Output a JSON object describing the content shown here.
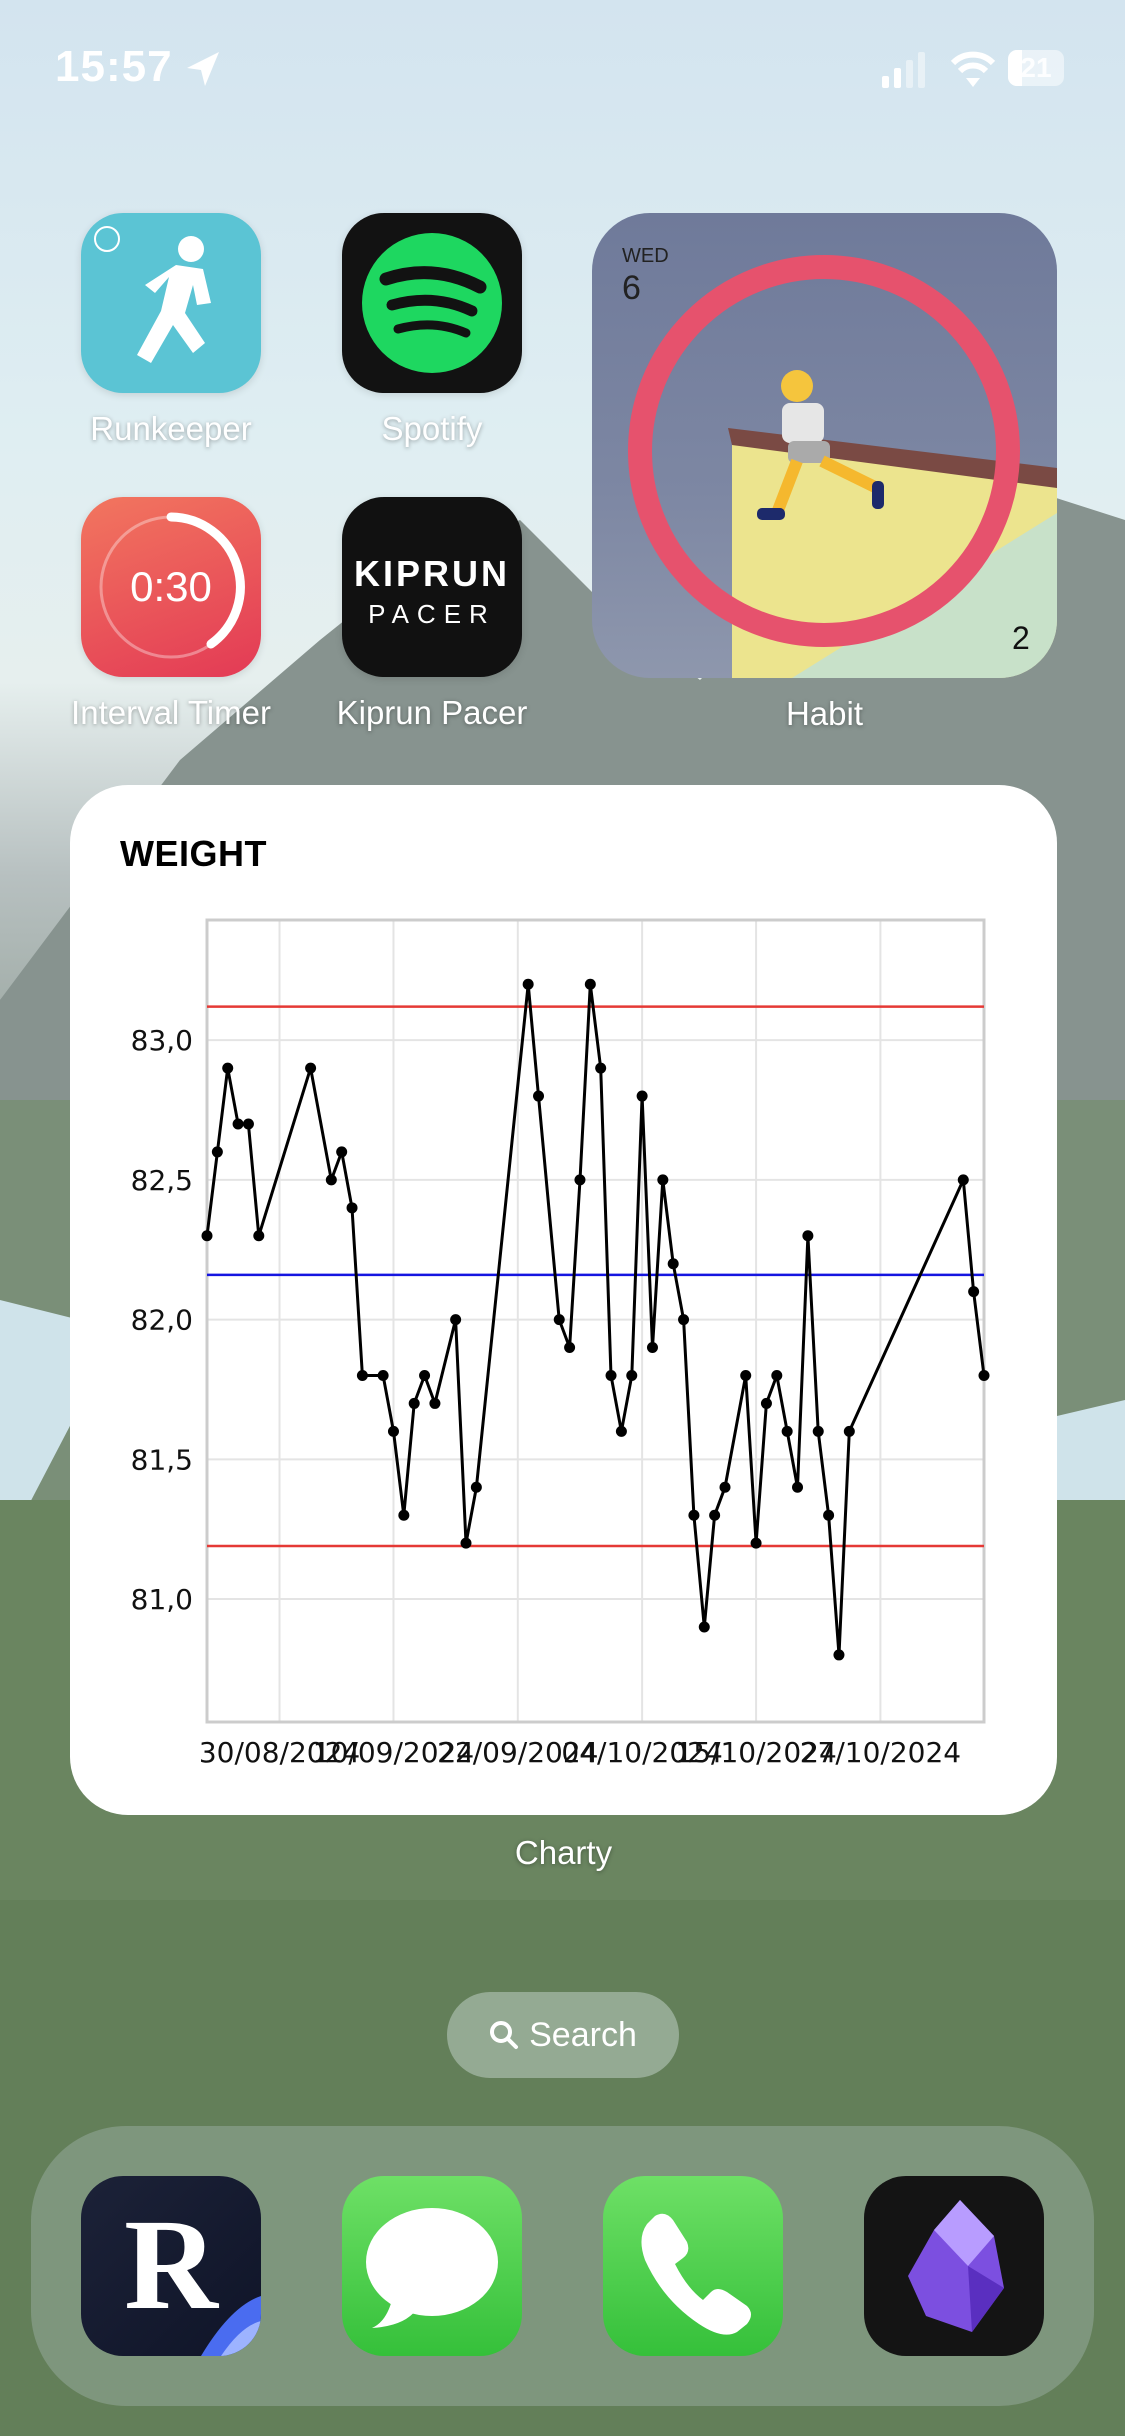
{
  "status_bar": {
    "time": "15:57",
    "battery_level": "21",
    "signal_bars_active": 2,
    "signal_bars_total": 4
  },
  "apps": [
    {
      "label": "Runkeeper",
      "icon": "runner-icon",
      "color": "#5BC4D4"
    },
    {
      "label": "Spotify",
      "icon": "spotify-icon",
      "color": "#1ED760"
    },
    {
      "label": "Interval Timer",
      "icon": "timer-icon",
      "color": "#E8405A",
      "icon_text": "0:30"
    },
    {
      "label": "Kiprun Pacer",
      "icon": "kiprun-icon",
      "color": "#111111",
      "icon_text_1": "KIPRUN",
      "icon_text_2": "PACER"
    }
  ],
  "habit_widget": {
    "label": "Habit",
    "weekday": "WED",
    "day": "6",
    "count": "2",
    "ring_color": "#E6526D"
  },
  "charty_widget": {
    "label": "Charty",
    "title": "WEIGHT"
  },
  "chart_data": {
    "type": "line",
    "title": "WEIGHT",
    "xlabel": "",
    "ylabel": "",
    "ylim": [
      80.56,
      83.43
    ],
    "xlim": [
      "23/08/2024",
      "06/11/2024"
    ],
    "grid": true,
    "y_ticks": [
      {
        "value": 81.0,
        "label": "81,0"
      },
      {
        "value": 81.5,
        "label": "81,5"
      },
      {
        "value": 82.0,
        "label": "82,0"
      },
      {
        "value": 82.5,
        "label": "82,5"
      },
      {
        "value": 83.0,
        "label": "83,0"
      }
    ],
    "x_ticks": [
      "30/08/2024",
      "10/09/2024",
      "22/09/2024",
      "04/10/2024",
      "15/10/2024",
      "27/10/2024"
    ],
    "reference_lines": [
      {
        "value": 83.12,
        "color": "#E53935"
      },
      {
        "value": 82.16,
        "color": "#1515E0"
      },
      {
        "value": 81.19,
        "color": "#E53935"
      }
    ],
    "series": [
      {
        "color": "#000000",
        "x": [
          "23/08/2024",
          "24/08/2024",
          "25/08/2024",
          "26/08/2024",
          "27/08/2024",
          "28/08/2024",
          "02/09/2024",
          "04/09/2024",
          "05/09/2024",
          "06/09/2024",
          "07/09/2024",
          "09/09/2024",
          "10/09/2024",
          "11/09/2024",
          "12/09/2024",
          "13/09/2024",
          "14/09/2024",
          "16/09/2024",
          "17/09/2024",
          "18/09/2024",
          "23/09/2024",
          "24/09/2024",
          "26/09/2024",
          "27/09/2024",
          "28/09/2024",
          "29/09/2024",
          "30/09/2024",
          "01/10/2024",
          "02/10/2024",
          "03/10/2024",
          "04/10/2024",
          "05/10/2024",
          "06/10/2024",
          "07/10/2024",
          "08/10/2024",
          "09/10/2024",
          "10/10/2024",
          "11/10/2024",
          "12/10/2024",
          "14/10/2024",
          "15/10/2024",
          "16/10/2024",
          "17/10/2024",
          "18/10/2024",
          "19/10/2024",
          "20/10/2024",
          "21/10/2024",
          "22/10/2024",
          "23/10/2024",
          "24/10/2024",
          "04/11/2024",
          "05/11/2024",
          "06/11/2024"
        ],
        "y": [
          82.3,
          82.6,
          82.9,
          82.7,
          82.7,
          82.3,
          82.9,
          82.5,
          82.6,
          82.4,
          81.8,
          81.8,
          81.6,
          81.3,
          81.7,
          81.8,
          81.7,
          82.0,
          81.2,
          81.4,
          83.2,
          82.8,
          82.0,
          81.9,
          82.5,
          83.2,
          82.9,
          81.8,
          81.6,
          81.8,
          82.8,
          81.9,
          82.5,
          82.2,
          82.0,
          81.3,
          80.9,
          81.3,
          81.4,
          81.8,
          81.2,
          81.7,
          81.8,
          81.6,
          81.4,
          82.3,
          81.6,
          81.3,
          80.8,
          81.6,
          82.5,
          82.1,
          81.8
        ]
      }
    ]
  },
  "search": {
    "label": "Search"
  },
  "dock": [
    {
      "name": "readwise-reader",
      "icon": "reader-r-icon",
      "letter": "R"
    },
    {
      "name": "messages",
      "icon": "message-bubble-icon"
    },
    {
      "name": "phone",
      "icon": "phone-handset-icon"
    },
    {
      "name": "obsidian",
      "icon": "obsidian-gem-icon"
    }
  ]
}
